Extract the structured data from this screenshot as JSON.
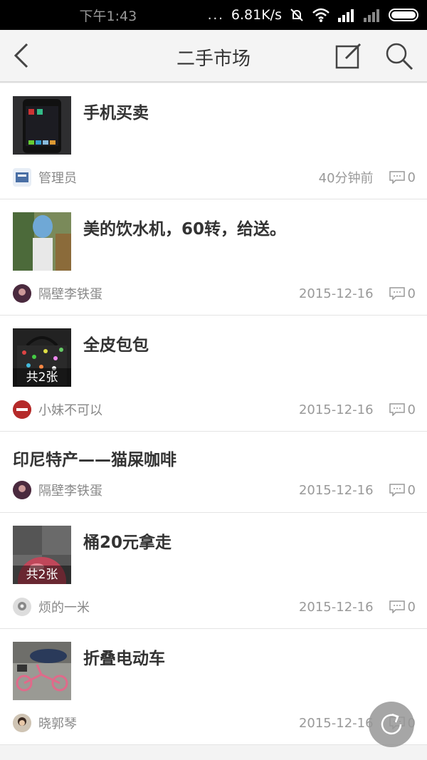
{
  "status_bar": {
    "time": "下午1:43",
    "dots": "...",
    "net_speed": "6.81K/s"
  },
  "header": {
    "title": "二手市场",
    "back_icon": "back-arrow-icon",
    "compose_icon": "compose-icon",
    "search_icon": "search-icon"
  },
  "posts": [
    {
      "title": "手机买卖",
      "author": "管理员",
      "time": "40分钟前",
      "comments": "0",
      "photo_count": "",
      "has_thumb": true
    },
    {
      "title": "美的饮水机，60转，给送。",
      "author": "隔壁李铁蛋",
      "time": "2015-12-16",
      "comments": "0",
      "photo_count": "",
      "has_thumb": true
    },
    {
      "title": "全皮包包",
      "author": "小妹不可以",
      "time": "2015-12-16",
      "comments": "0",
      "photo_count": "共2张",
      "has_thumb": true
    },
    {
      "title": "印尼特产——猫屎咖啡",
      "author": "隔壁李铁蛋",
      "time": "2015-12-16",
      "comments": "0",
      "photo_count": "",
      "has_thumb": false
    },
    {
      "title": "桶20元拿走",
      "author": "烦的一米",
      "time": "2015-12-16",
      "comments": "0",
      "photo_count": "共2张",
      "has_thumb": true
    },
    {
      "title": "折叠电动车",
      "author": "晓郭琴",
      "time": "2015-12-16",
      "comments": "0",
      "photo_count": "",
      "has_thumb": true
    }
  ],
  "fab": {
    "icon": "refresh-icon"
  },
  "colors": {
    "status_bar_bg": "#000000",
    "header_bg": "#f4f4f4",
    "title_text": "#333333",
    "meta_text": "#888888"
  }
}
